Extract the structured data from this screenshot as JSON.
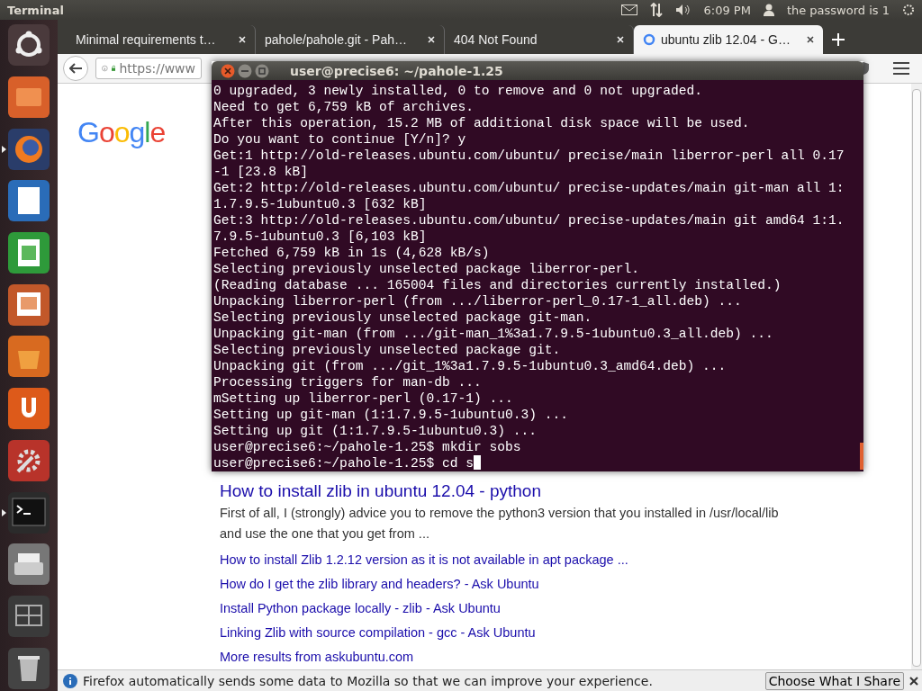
{
  "top_panel": {
    "app_name": "Terminal",
    "time": "6:09 PM",
    "user": "the password is 1"
  },
  "launcher": [
    {
      "kind": "ubuntu",
      "selected": false
    },
    {
      "kind": "files",
      "selected": false
    },
    {
      "kind": "firefox",
      "selected": true
    },
    {
      "kind": "writer",
      "selected": false
    },
    {
      "kind": "calc",
      "selected": false
    },
    {
      "kind": "impress",
      "selected": false
    },
    {
      "kind": "software",
      "selected": false
    },
    {
      "kind": "ubuntuone",
      "selected": false
    },
    {
      "kind": "settings",
      "selected": false
    },
    {
      "kind": "terminal",
      "selected": true
    },
    {
      "kind": "scanner",
      "selected": false
    },
    {
      "kind": "workspaces",
      "selected": false
    },
    {
      "kind": "trash",
      "selected": false
    }
  ],
  "browser": {
    "tabs": [
      {
        "title": "Minimal requirements t…",
        "selected": false
      },
      {
        "title": "pahole/pahole.git - Pah…",
        "selected": false
      },
      {
        "title": "404 Not Found",
        "selected": false
      },
      {
        "title": "ubuntu zlib 12.04 - G…",
        "selected": true
      }
    ],
    "url": "https://www",
    "logo": "Google",
    "result": {
      "title": "How to install zlib in ubuntu 12.04 - python",
      "snippet": [
        "First of all, I (strongly) advice you to remove the python3 version that you installed in /usr/local/lib",
        "and use the one that you get from ..."
      ],
      "links": [
        "How to install Zlib 1.2.12 version as it is not available in apt package ...",
        "How do I get the zlib library and headers? - Ask Ubuntu",
        "Install Python package locally - zlib - Ask Ubuntu",
        "Linking Zlib with source compilation - gcc - Ask Ubuntu",
        "More results from askubuntu.com"
      ]
    },
    "notification": {
      "text": "Firefox automatically sends some data to Mozilla so that we can improve your experience.",
      "button": "Choose What I Share"
    }
  },
  "terminal": {
    "title": "user@precise6: ~/pahole-1.25",
    "lines": [
      "0 upgraded, 3 newly installed, 0 to remove and 0 not upgraded.",
      "Need to get 6,759 kB of archives.",
      "After this operation, 15.2 MB of additional disk space will be used.",
      "Do you want to continue [Y/n]? y",
      "Get:1 http://old-releases.ubuntu.com/ubuntu/ precise/main liberror-perl all 0.17",
      "-1 [23.8 kB]",
      "Get:2 http://old-releases.ubuntu.com/ubuntu/ precise-updates/main git-man all 1:",
      "1.7.9.5-1ubuntu0.3 [632 kB]",
      "Get:3 http://old-releases.ubuntu.com/ubuntu/ precise-updates/main git amd64 1:1.",
      "7.9.5-1ubuntu0.3 [6,103 kB]",
      "Fetched 6,759 kB in 1s (4,628 kB/s)",
      "Selecting previously unselected package liberror-perl.",
      "(Reading database ... 165004 files and directories currently installed.)",
      "Unpacking liberror-perl (from .../liberror-perl_0.17-1_all.deb) ...",
      "Selecting previously unselected package git-man.",
      "Unpacking git-man (from .../git-man_1%3a1.7.9.5-1ubuntu0.3_all.deb) ...",
      "Selecting previously unselected package git.",
      "Unpacking git (from .../git_1%3a1.7.9.5-1ubuntu0.3_amd64.deb) ...",
      "Processing triggers for man-db ...",
      "mSetting up liberror-perl (0.17-1) ...",
      "Setting up git-man (1:1.7.9.5-1ubuntu0.3) ...",
      "Setting up git (1:1.7.9.5-1ubuntu0.3) ...",
      "user@precise6:~/pahole-1.25$ mkdir sobs"
    ],
    "prompt": "user@precise6:~/pahole-1.25$ cd s"
  }
}
